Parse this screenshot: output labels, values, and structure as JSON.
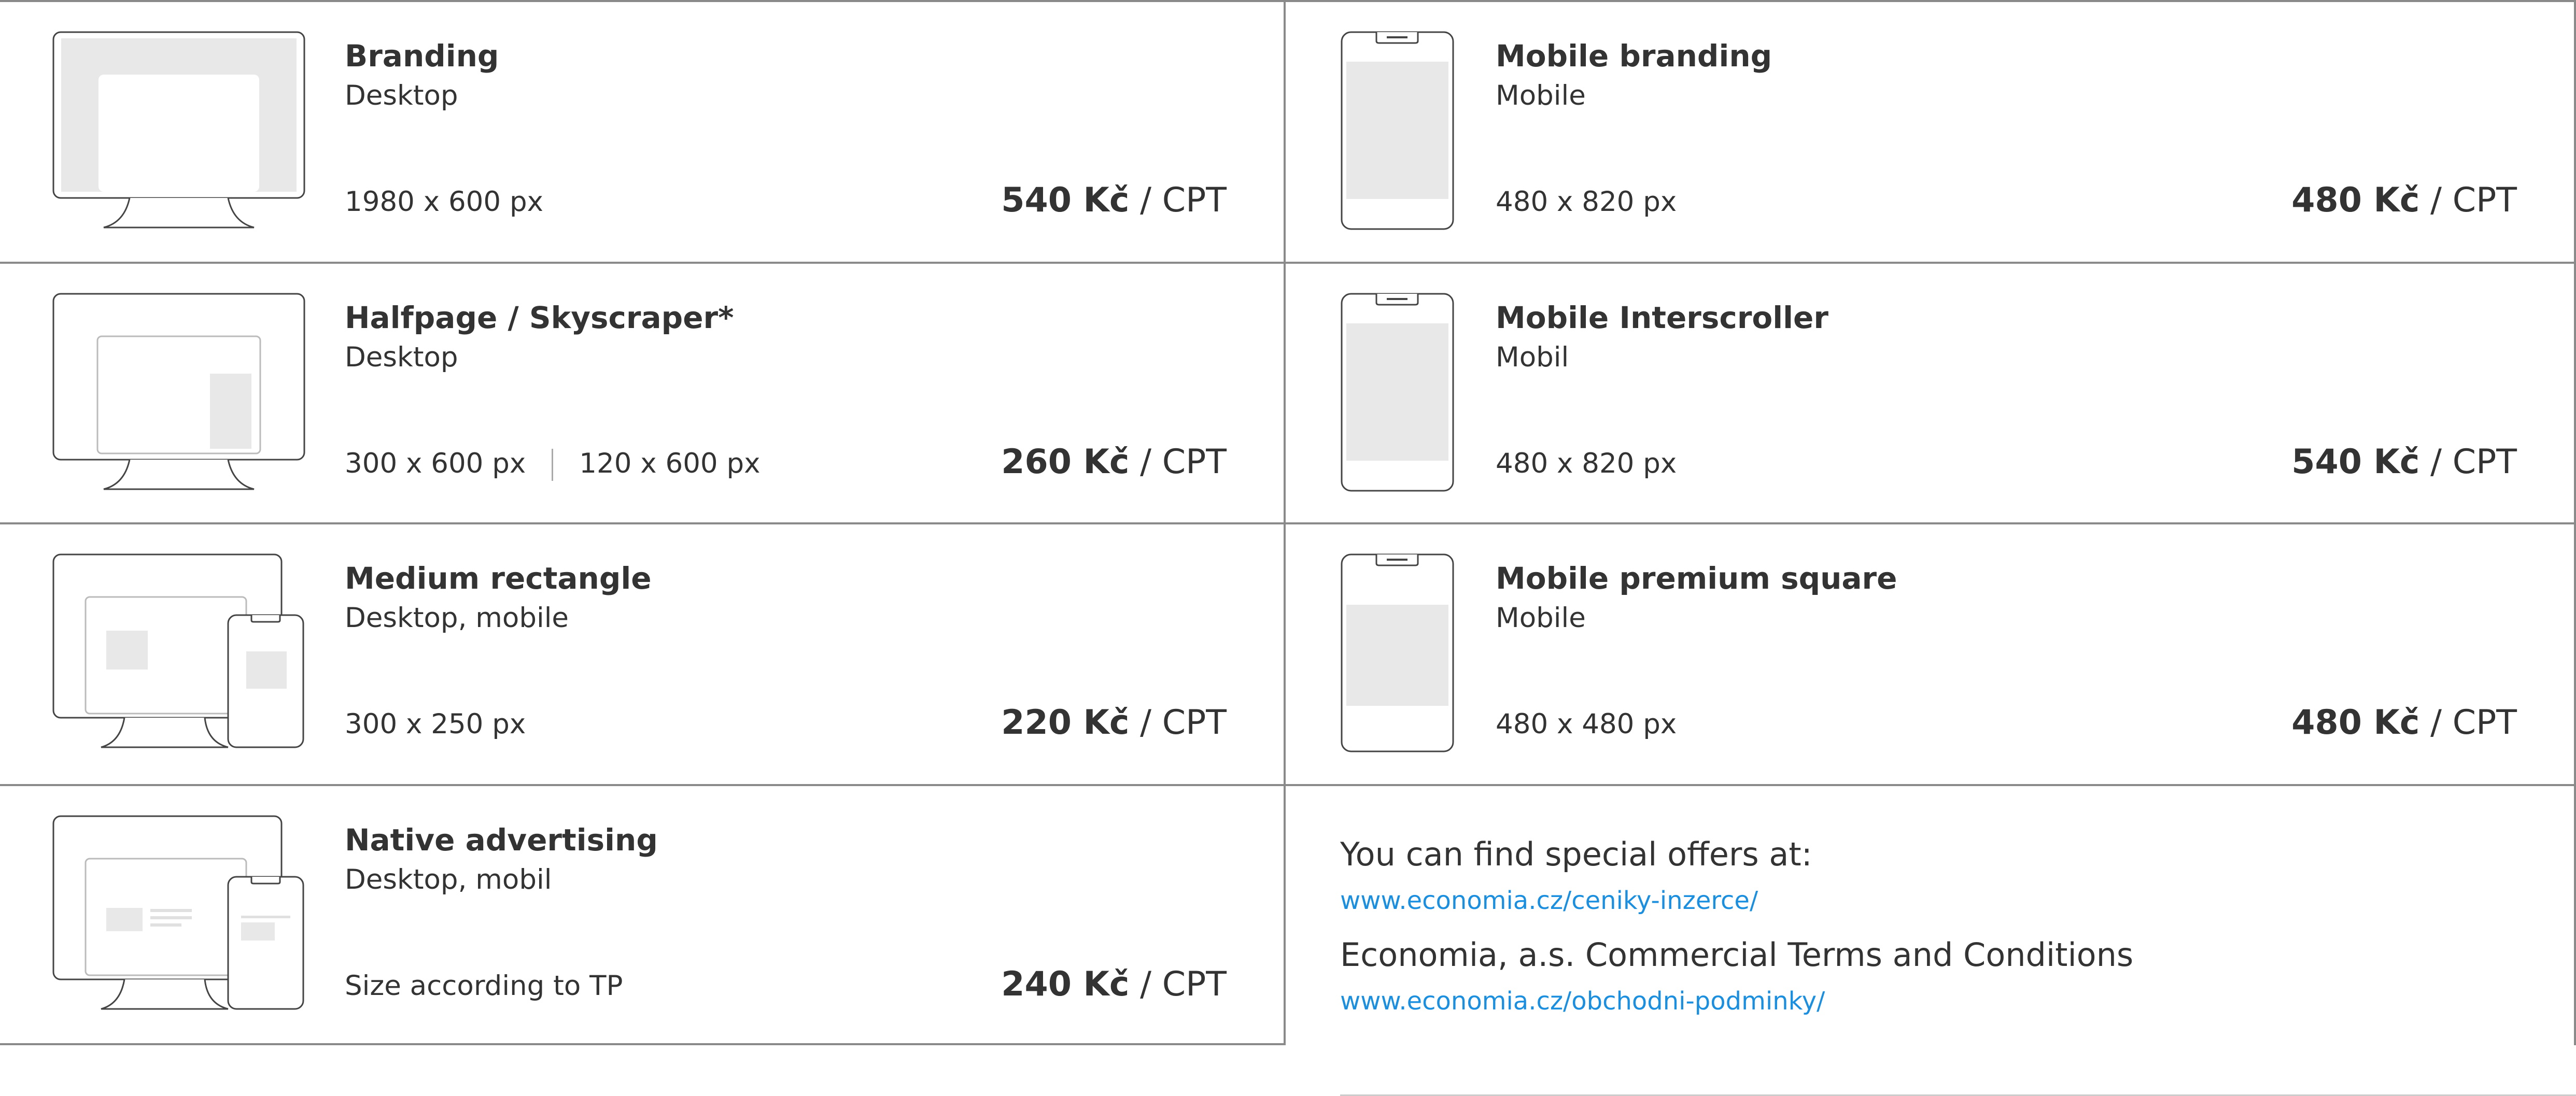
{
  "products": [
    {
      "name": "Branding",
      "platform": "Desktop",
      "size": "1980 x 600 px",
      "size2": "",
      "price": "540 Kč",
      "unit": "/ CPT",
      "icon": "desktop-branding-icon"
    },
    {
      "name": "Mobile branding",
      "platform": "Mobile",
      "size": "480 x 820 px",
      "size2": "",
      "price": "480 Kč",
      "unit": "/ CPT",
      "icon": "mobile-branding-icon"
    },
    {
      "name": "Halfpage / Skyscraper*",
      "platform": "Desktop",
      "size": "300 x 600 px",
      "size2": "120 x 600 px",
      "price": "260 Kč",
      "unit": "/ CPT",
      "icon": "desktop-halfpage-icon"
    },
    {
      "name": "Mobile Interscroller",
      "platform": "Mobil",
      "size": "480 x 820 px",
      "size2": "",
      "price": "540 Kč",
      "unit": "/ CPT",
      "icon": "mobile-interscroller-icon"
    },
    {
      "name": "Medium rectangle",
      "platform": "Desktop, mobile",
      "size": "300 x 250 px",
      "size2": "",
      "price": "220 Kč",
      "unit": "/ CPT",
      "icon": "desktop-mobile-rectangle-icon"
    },
    {
      "name": "Mobile premium square",
      "platform": "Mobile",
      "size": "480 x 480 px",
      "size2": "",
      "price": "480 Kč",
      "unit": "/ CPT",
      "icon": "mobile-square-icon"
    },
    {
      "name": "Native advertising",
      "platform": "Desktop, mobil",
      "size": "Size according to TP",
      "size2": "",
      "price": "240 Kč",
      "unit": "/ CPT",
      "icon": "native-advertising-icon"
    }
  ],
  "offers": {
    "heading": "You can find special offers at:",
    "offers_link": "www.economia.cz/ceniky-inzerce/",
    "terms_heading": "Economia, a.s. Commercial Terms and Conditions",
    "terms_link": "www.economia.cz/obchodni-podminky/"
  },
  "colors": {
    "text": "#333333",
    "link": "#1a8fe0",
    "border": "#8a8a8a",
    "placeholder": "#e8e8e8"
  }
}
